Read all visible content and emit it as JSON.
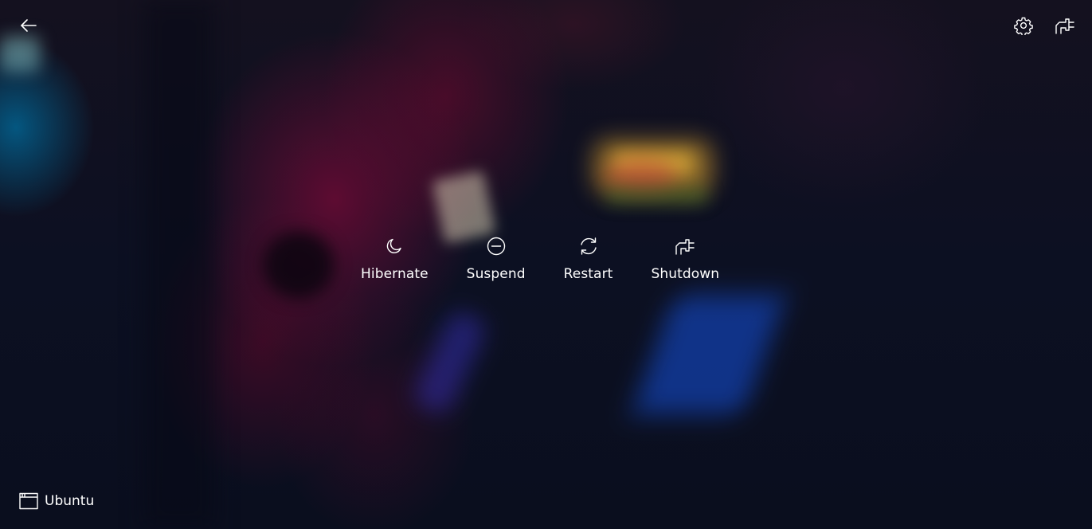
{
  "background": {
    "description_colors": [
      "#0b0f22",
      "#780a37",
      "#006ea0",
      "#e6aa32",
      "#1450dc"
    ]
  },
  "header": {
    "back_icon": "arrow-left-icon",
    "settings_icon": "gear-icon",
    "power_icon": "power-plug-icon"
  },
  "power_options": [
    {
      "label": "Hibernate",
      "icon": "moon-icon"
    },
    {
      "label": "Suspend",
      "icon": "minus-circle-icon"
    },
    {
      "label": "Restart",
      "icon": "refresh-icon"
    },
    {
      "label": "Shutdown",
      "icon": "power-plug-icon"
    }
  ],
  "session": {
    "label": "Ubuntu",
    "icon": "window-icon"
  },
  "colors": {
    "text": "#ffffff",
    "icon_stroke": "#ffffff"
  }
}
